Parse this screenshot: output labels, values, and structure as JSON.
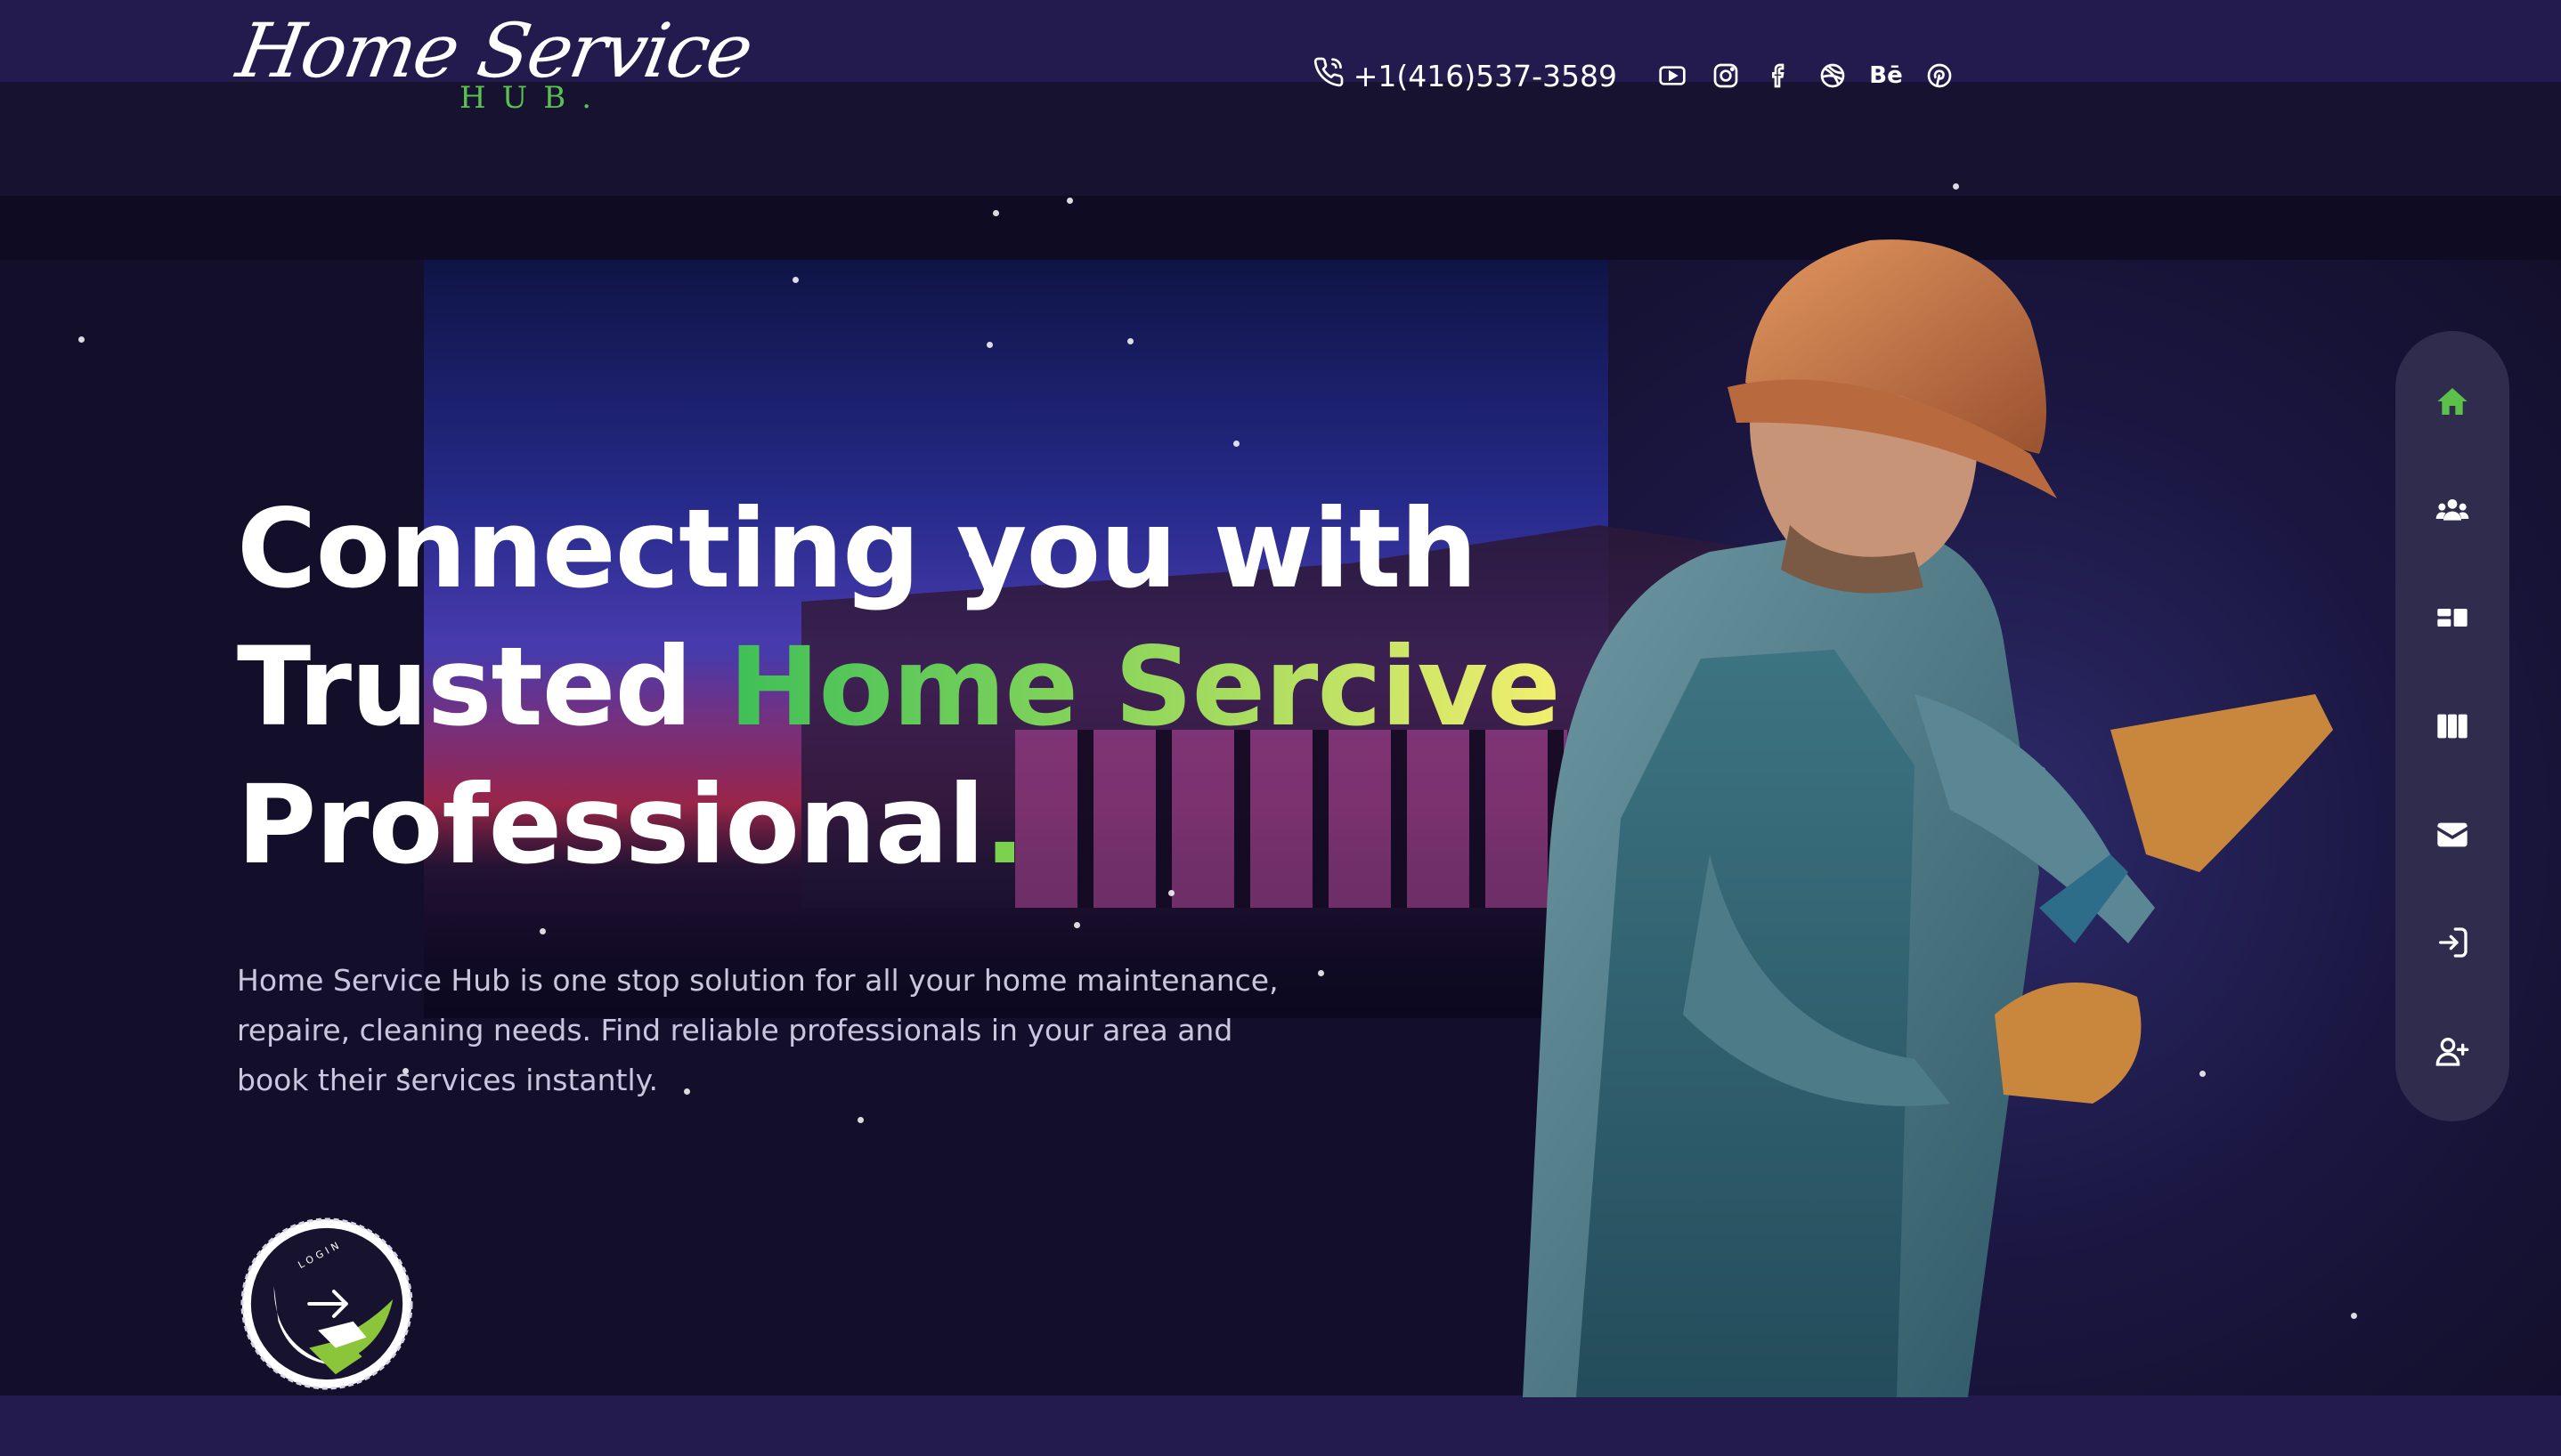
{
  "brand": {
    "name": "Home Service",
    "sub": "HUB",
    "dot": "."
  },
  "header": {
    "phone": "+1(416)537-3589",
    "socials": [
      {
        "name": "youtube-icon"
      },
      {
        "name": "instagram-icon"
      },
      {
        "name": "facebook-icon"
      },
      {
        "name": "dribbble-icon"
      },
      {
        "name": "behance-icon",
        "label": "Bē"
      },
      {
        "name": "pinterest-icon"
      }
    ]
  },
  "hero": {
    "line1": "Connecting you with",
    "line2_a": "Trusted ",
    "line2_b": "Home Sercive",
    "line3": "Professional",
    "line3_dot": ".",
    "desc1": "Home Service Hub is one stop solution for all your home maintenance,",
    "desc2": "repaire, cleaning needs. Find reliable professionals in your area and",
    "desc3": "book their services instantly."
  },
  "login_badge": {
    "label": "LOGIN"
  },
  "side_nav": {
    "items": [
      {
        "name": "home-icon",
        "active": true
      },
      {
        "name": "team-icon"
      },
      {
        "name": "services-icon"
      },
      {
        "name": "columns-icon"
      },
      {
        "name": "mail-icon"
      },
      {
        "name": "login-icon"
      },
      {
        "name": "add-user-icon"
      }
    ]
  },
  "colors": {
    "accent_green": "#59c152",
    "gradient_start": "#3fbf58",
    "gradient_end": "#f3ef6e",
    "background": "#130f2b",
    "nav_bg": "#2f2c4e"
  }
}
